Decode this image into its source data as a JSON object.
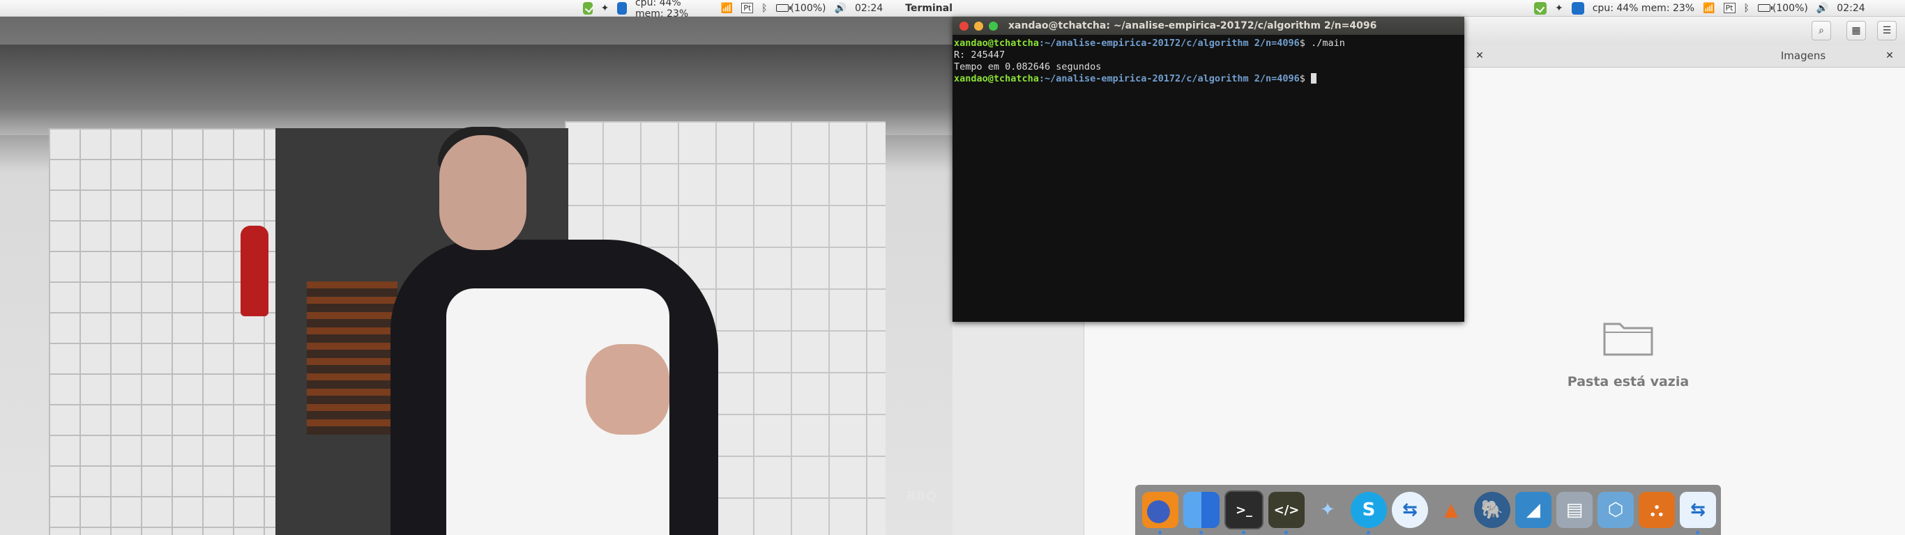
{
  "panels": {
    "cpu_mem": "cpu: 44% mem: 23%",
    "language": "Pt",
    "battery": "(100%)",
    "clock": "02:24",
    "active_app": "Terminal"
  },
  "terminal": {
    "title": "xandao@tchatcha: ~/analise-empirica-20172/c/algorithm 2/n=4096",
    "prompt_user": "xandao@tchatcha",
    "prompt_path": ":~/analise-empirica-20172/c/algorithm 2/n=4096",
    "prompt_symbol": "$ ",
    "command": "./main",
    "output_line_1": "R: 245447",
    "output_line_2": "Tempo em 0.082646 segundos"
  },
  "file_manager": {
    "tab_label": "Imagens",
    "empty_message": "Pasta está vazia"
  },
  "video": {
    "watermark": "BBQ"
  },
  "dock": {
    "apps": [
      "firefox-icon",
      "finder-icon",
      "terminal-icon",
      "code-editor-icon",
      "dropbox-icon",
      "skype-icon",
      "teamviewer-icon",
      "matlab-icon",
      "postgresql-icon",
      "mysql-workbench-icon",
      "file-manager-icon",
      "virtualbox-icon",
      "ubuntu-software-icon",
      "teamviewer-remote-icon"
    ]
  },
  "colors": {
    "prompt_user": "#8ae234",
    "prompt_path": "#729fcf",
    "terminal_bg": "#111111",
    "dock_bg": "#787878"
  }
}
